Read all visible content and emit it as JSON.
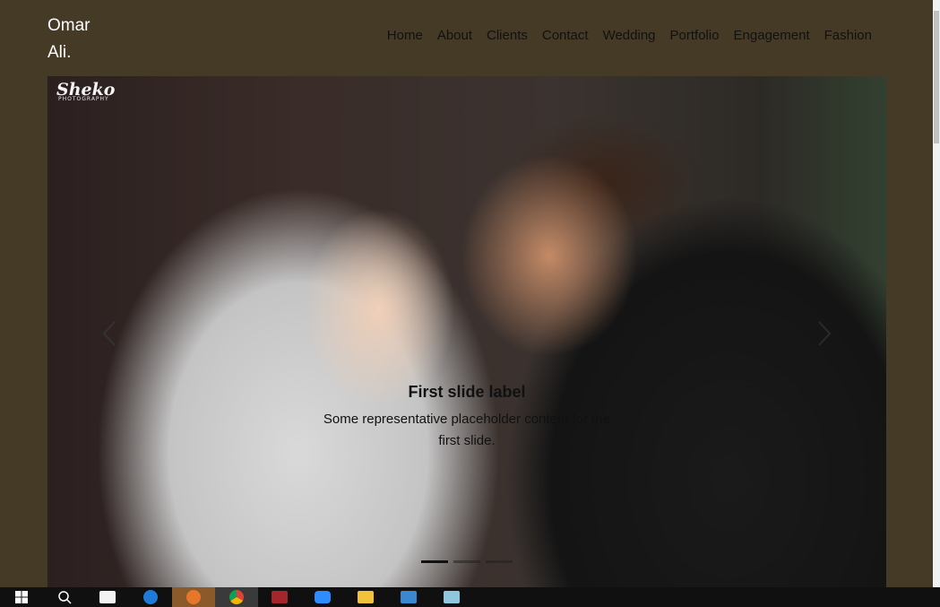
{
  "brand": {
    "line1": "Omar",
    "line2": "Ali."
  },
  "nav": {
    "items": [
      {
        "label": "Home"
      },
      {
        "label": "About"
      },
      {
        "label": "Clients"
      },
      {
        "label": "Contact"
      },
      {
        "label": "Wedding"
      },
      {
        "label": "Portfolio"
      },
      {
        "label": "Engagement"
      },
      {
        "label": "Fashion"
      }
    ]
  },
  "carousel": {
    "watermark": "Sheko",
    "watermark_sub": "PHOTOGRAPHY",
    "caption": {
      "title": "First slide label",
      "text": "Some representative placeholder content for the first slide."
    },
    "slide_count": 3,
    "active_slide": 1
  },
  "taskbar": {
    "icons": [
      "windows-start-icon",
      "search-icon",
      "store-icon",
      "edge-icon",
      "firefox-icon",
      "chrome-icon",
      "access-icon",
      "zoom-icon",
      "file-explorer-icon",
      "app-icon",
      "notepad-icon"
    ]
  }
}
